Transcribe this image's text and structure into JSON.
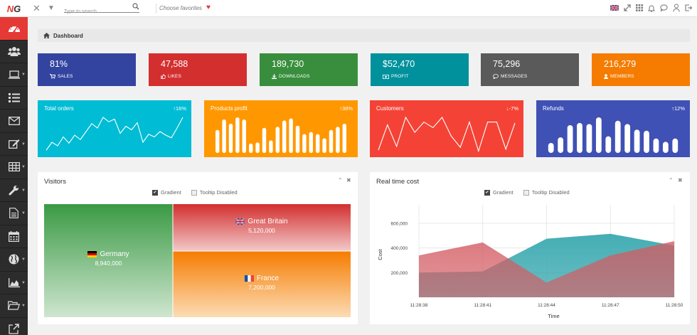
{
  "topbar": {
    "logo_a": "N",
    "logo_b": "G",
    "search_placeholder": "Type to search...",
    "favorites_label": "Choose favorites"
  },
  "sidebar": {
    "items": [
      {
        "icon": "dashboard-icon",
        "active": true
      },
      {
        "icon": "users-icon"
      },
      {
        "icon": "laptop-icon",
        "chevron": true
      },
      {
        "icon": "list-icon"
      },
      {
        "icon": "envelope-icon"
      },
      {
        "icon": "edit-icon",
        "chevron": true
      },
      {
        "icon": "table-icon",
        "chevron": true
      },
      {
        "icon": "wrench-icon",
        "chevron": true
      },
      {
        "icon": "file-icon",
        "chevron": true
      },
      {
        "icon": "calendar-icon"
      },
      {
        "icon": "globe-icon",
        "chevron": true
      },
      {
        "icon": "area-chart-icon",
        "chevron": true
      },
      {
        "icon": "folder-open-icon",
        "chevron": true
      },
      {
        "icon": "external-link-icon"
      }
    ]
  },
  "breadcrumb": {
    "label": "Dashboard"
  },
  "tiles": [
    {
      "value": "81%",
      "label": "SALES",
      "color": "#3344a0",
      "icon": "cart-icon"
    },
    {
      "value": "47,588",
      "label": "LIKES",
      "color": "#d32f2f",
      "icon": "thumbs-up-icon"
    },
    {
      "value": "189,730",
      "label": "DOWNLOADS",
      "color": "#388e3c",
      "icon": "download-icon"
    },
    {
      "value": "$52,470",
      "label": "PROFIT",
      "color": "#00919c",
      "icon": "money-icon"
    },
    {
      "value": "75,296",
      "label": "MESSAGES",
      "color": "#5a5a5a",
      "icon": "comment-icon"
    },
    {
      "value": "216,279",
      "label": "MEMBERS",
      "color": "#f57c00",
      "icon": "user-icon"
    }
  ],
  "cards": [
    {
      "title": "Total orders",
      "pct": "16%",
      "trend": "up",
      "color": "#00bcd4"
    },
    {
      "title": "Products profit",
      "pct": "38%",
      "trend": "up",
      "color": "#ff9800"
    },
    {
      "title": "Customers",
      "pct": "-7%",
      "trend": "down",
      "color": "#f44336"
    },
    {
      "title": "Refunds",
      "pct": "12%",
      "trend": "up",
      "color": "#3f51b5"
    }
  ],
  "visitors": {
    "title": "Visitors",
    "opt_gradient": "Gradient",
    "opt_tooltip": "Tooltip Disabled",
    "items": [
      {
        "name": "Germany",
        "value": "8,940,000",
        "color": "#3a9a44"
      },
      {
        "name": "Great Britain",
        "value": "5,120,000",
        "color": "#d32f2f"
      },
      {
        "name": "France",
        "value": "7,200,000",
        "color": "#f57c00"
      }
    ]
  },
  "realtime": {
    "title": "Real time cost",
    "opt_gradient": "Gradient",
    "opt_tooltip": "Tooltip Disabled"
  },
  "chart_data": [
    {
      "type": "line",
      "title": "Total orders",
      "values": [
        3,
        12,
        8,
        18,
        11,
        20,
        15,
        24,
        33,
        28,
        40,
        35,
        38,
        22,
        30,
        26,
        34,
        12,
        21,
        18,
        24,
        20,
        17,
        28,
        40
      ]
    },
    {
      "type": "bar",
      "title": "Products profit",
      "values": [
        22,
        32,
        28,
        34,
        32,
        9,
        10,
        24,
        12,
        25,
        31,
        33,
        26,
        18,
        20,
        18,
        14,
        22,
        25,
        28
      ]
    },
    {
      "type": "line",
      "title": "Customers",
      "values": [
        3,
        30,
        7,
        38,
        22,
        33,
        27,
        38,
        18,
        6,
        33,
        2,
        33,
        33,
        4,
        32
      ]
    },
    {
      "type": "bar",
      "title": "Refunds",
      "values": [
        9,
        14,
        25,
        27,
        26,
        32,
        15,
        29,
        26,
        21,
        20,
        13,
        10,
        13
      ]
    },
    {
      "type": "treemap",
      "title": "Visitors",
      "labels": [
        "Germany",
        "Great Britain",
        "France"
      ],
      "values": [
        8940000,
        5120000,
        7200000
      ]
    },
    {
      "type": "area",
      "title": "Real time cost",
      "xlabel": "Time",
      "ylabel": "Cost",
      "categories": [
        "11:28:38",
        "11:28:41",
        "11:28:44",
        "11:28:47",
        "11:28:50"
      ],
      "yticks": [
        "200,000",
        "400,000",
        "600,000"
      ],
      "ylim": [
        0,
        750000
      ],
      "grid": true,
      "series": [
        {
          "color": "#3aa9b0",
          "values": [
            200000,
            210000,
            475000,
            515000,
            420000
          ]
        },
        {
          "color": "#d35c63",
          "values": [
            340000,
            445000,
            120000,
            340000,
            455000
          ]
        }
      ]
    }
  ]
}
